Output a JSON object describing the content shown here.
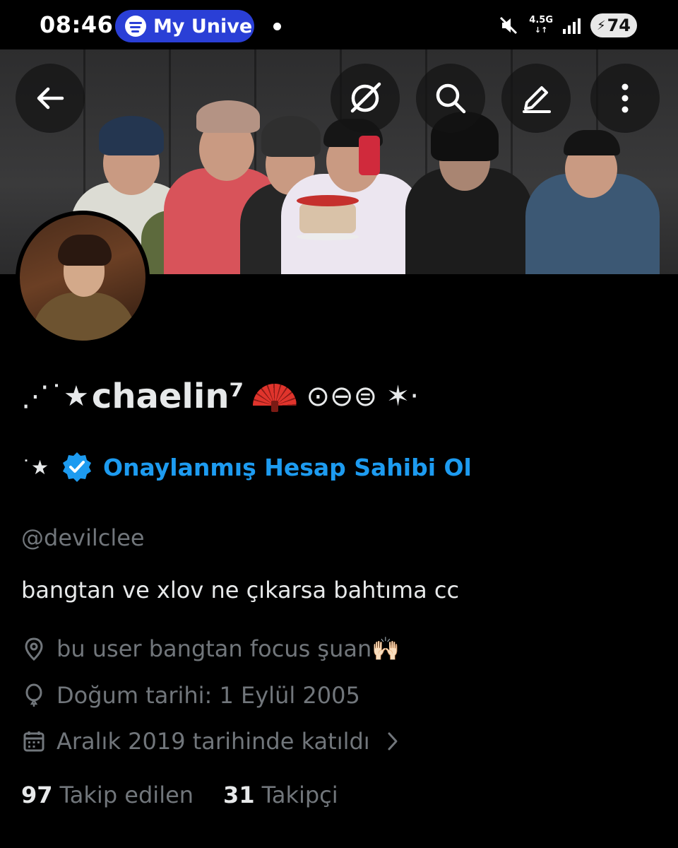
{
  "status_bar": {
    "time": "08:46",
    "media_pill": "My Unive",
    "network": "4.5G",
    "battery": "74",
    "icons": [
      "spotify-icon",
      "mute-icon",
      "signal-icon",
      "battery-icon"
    ]
  },
  "header": {
    "icons": [
      "back-arrow-icon",
      "grok-icon",
      "search-icon",
      "edit-icon",
      "more-icon"
    ]
  },
  "profile": {
    "name_prefix": "⋰˙★",
    "name": "chaelin⁷",
    "name_suffix": "⊙⊖⊜ ✶⋅",
    "verify_prefix": "˙★",
    "verify_link": "Onaylanmış Hesap Sahibi Ol",
    "handle": "@devilclee",
    "bio": "bangtan ve xlov ne çıkarsa bahtıma cc",
    "location": "bu user bangtan focus şuan🙌🏻",
    "birthday": "Doğum tarihi: 1 Eylül 2005",
    "joined": "Aralık 2019 tarihinde katıldı",
    "following_count": "97",
    "following_label": "Takip edilen",
    "followers_count": "31",
    "followers_label": "Takipçi"
  },
  "colors": {
    "accent": "#1d9bf0",
    "background": "#000000",
    "muted_text": "#71767b",
    "primary_text": "#e7e9ea",
    "pill": "#2a3fd6"
  }
}
